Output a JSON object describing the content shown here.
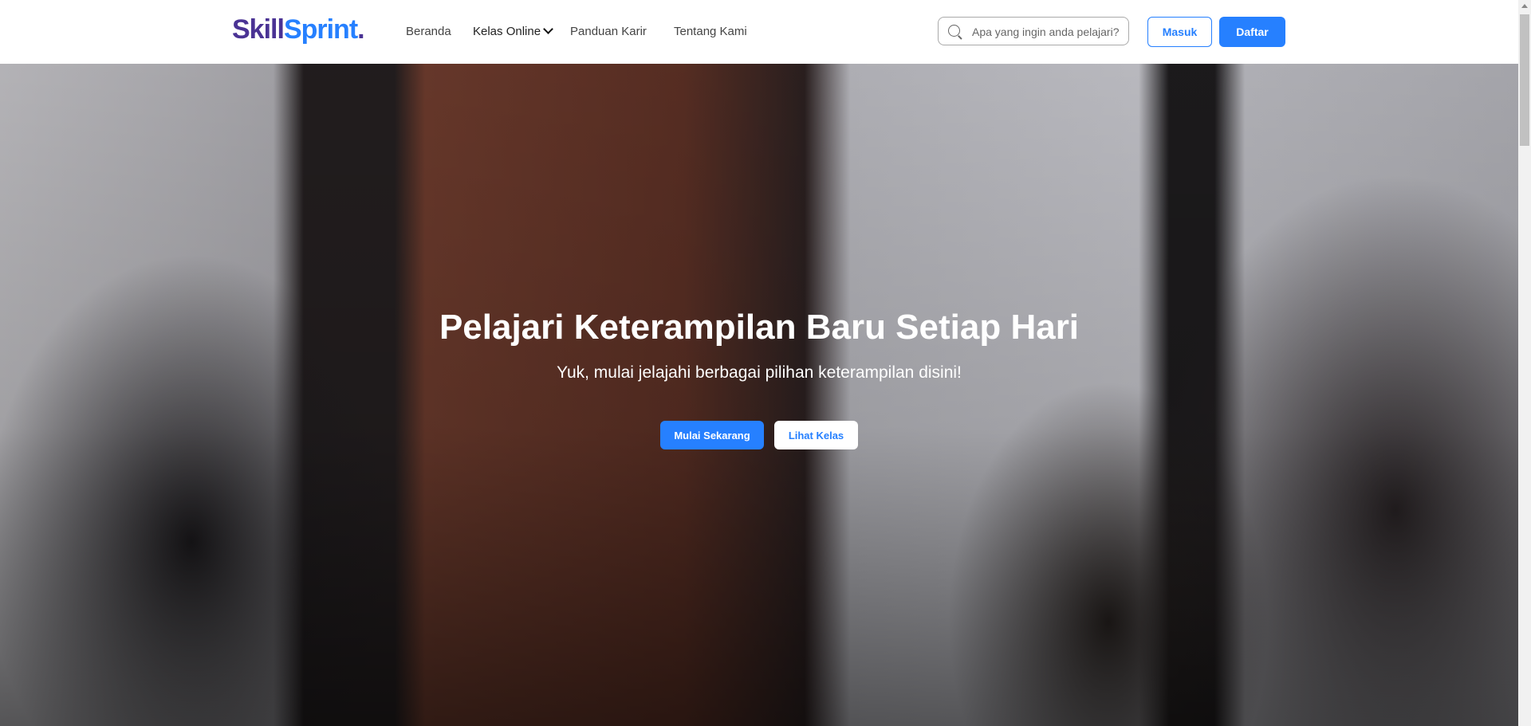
{
  "brand": {
    "part1": "Skill",
    "part2": "Sprint",
    "dot": ".",
    "colors": {
      "primary": "#4a3394",
      "accent": "#2680ff"
    }
  },
  "nav": {
    "items": [
      {
        "label": "Beranda"
      },
      {
        "label": "Kelas Online",
        "has_dropdown": true
      },
      {
        "label": "Panduan Karir"
      },
      {
        "label": "Tentang Kami"
      }
    ]
  },
  "search": {
    "placeholder": "Apa yang ingin anda pelajari?",
    "value": "",
    "icon": "search-icon"
  },
  "auth": {
    "login_label": "Masuk",
    "register_label": "Daftar"
  },
  "hero": {
    "title": "Pelajari Keterampilan Baru Setiap Hari",
    "subtitle": "Yuk, mulai jelajahi berbagai pilihan keterampilan disini!",
    "primary_cta": "Mulai Sekarang",
    "secondary_cta": "Lihat Kelas"
  }
}
